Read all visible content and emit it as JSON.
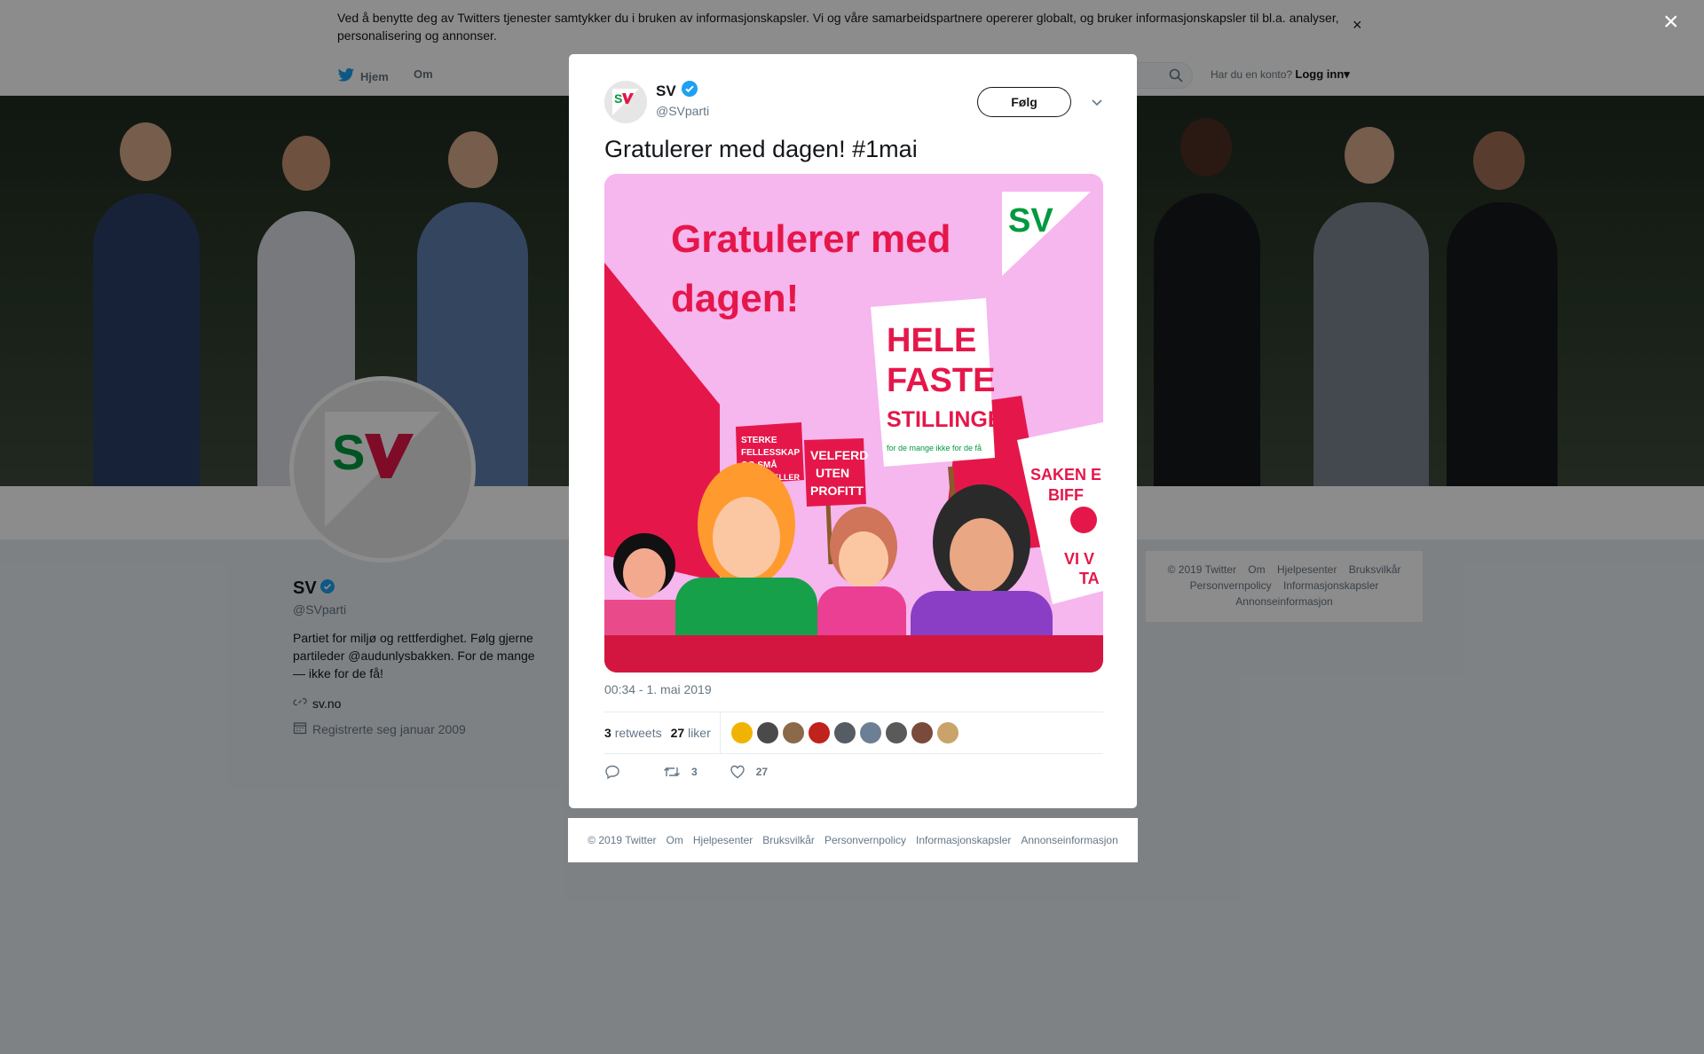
{
  "cookie_banner": {
    "text": "Ved å benytte deg av Twitters tjenester samtykker du i bruken av informasjonskapsler. Vi og våre samarbeidspartnere opererer globalt, og bruker informasjonskapsler til bl.a. analyser, personalisering og annonser.",
    "close_label": "×"
  },
  "nav": {
    "home_label": "Hjem",
    "about_label": "Om",
    "login_prompt": "Har du en konto?",
    "login_label": "Logg inn"
  },
  "profile": {
    "name": "SV",
    "handle": "@SVparti",
    "bio": "Partiet for miljø og rettferdighet. Følg gjerne partileder @audunlysbakken. For de mange — ikke for de få!",
    "website": "sv.no",
    "joined": "Registrerte seg januar 2009"
  },
  "right_footer": {
    "links": [
      "© 2019 Twitter",
      "Om",
      "Hjelpesenter",
      "Bruksvilkår",
      "Personvernpolicy",
      "Informasjonskapsler",
      "Annonseinformasjon"
    ]
  },
  "overlay_close": "×",
  "tweet": {
    "author_name": "SV",
    "author_handle": "@SVparti",
    "follow_label": "Følg",
    "text": "Gratulerer med dagen! #1mai",
    "time": "00:34 - 1. mai 2019",
    "retweets_count": "3",
    "retweets_label": "retweets",
    "likes_count": "27",
    "likes_label": "liker",
    "reply_count": "",
    "retweet_action_count": "3",
    "like_action_count": "27",
    "image": {
      "headline_line1": "Gratulerer med",
      "headline_line2": "dagen!",
      "logo_text": "SV",
      "sign_big_line1": "HELE",
      "sign_big_line2": "FASTE",
      "sign_big_line3": "STILLINGER",
      "sign_big_sub": "for de mange ikke for de få",
      "sign_left_line1": "STERKE",
      "sign_left_line2": "FELLESSKAP",
      "sign_left_line3": "OG SMÅ",
      "sign_left_line4": "FORSKJELLER",
      "sign_mid_line1": "VELFERD",
      "sign_mid_line2": "UTEN",
      "sign_mid_line3": "PROFITT",
      "sign_right_line1": "SAKEN E",
      "sign_right_line2": "BIFF",
      "sign_right_line3": "VI V",
      "sign_right_line4": "TA"
    },
    "liker_colors": [
      "#f0b400",
      "#4a4a4a",
      "#8a6a4a",
      "#c0221c",
      "#555c63",
      "#6d7f94",
      "#5a5a5a",
      "#7a4a3a",
      "#c9a36a"
    ]
  },
  "modal_footer": {
    "links": [
      "© 2019 Twitter",
      "Om",
      "Hjelpesenter",
      "Bruksvilkår",
      "Personvernpolicy",
      "Informasjonskapsler",
      "Annonseinformasjon"
    ]
  },
  "colors": {
    "brand_red": "#e5174a",
    "brand_green": "#009a3e",
    "verified_blue": "#1da1f2",
    "image_bg": "#f6b6ee"
  }
}
